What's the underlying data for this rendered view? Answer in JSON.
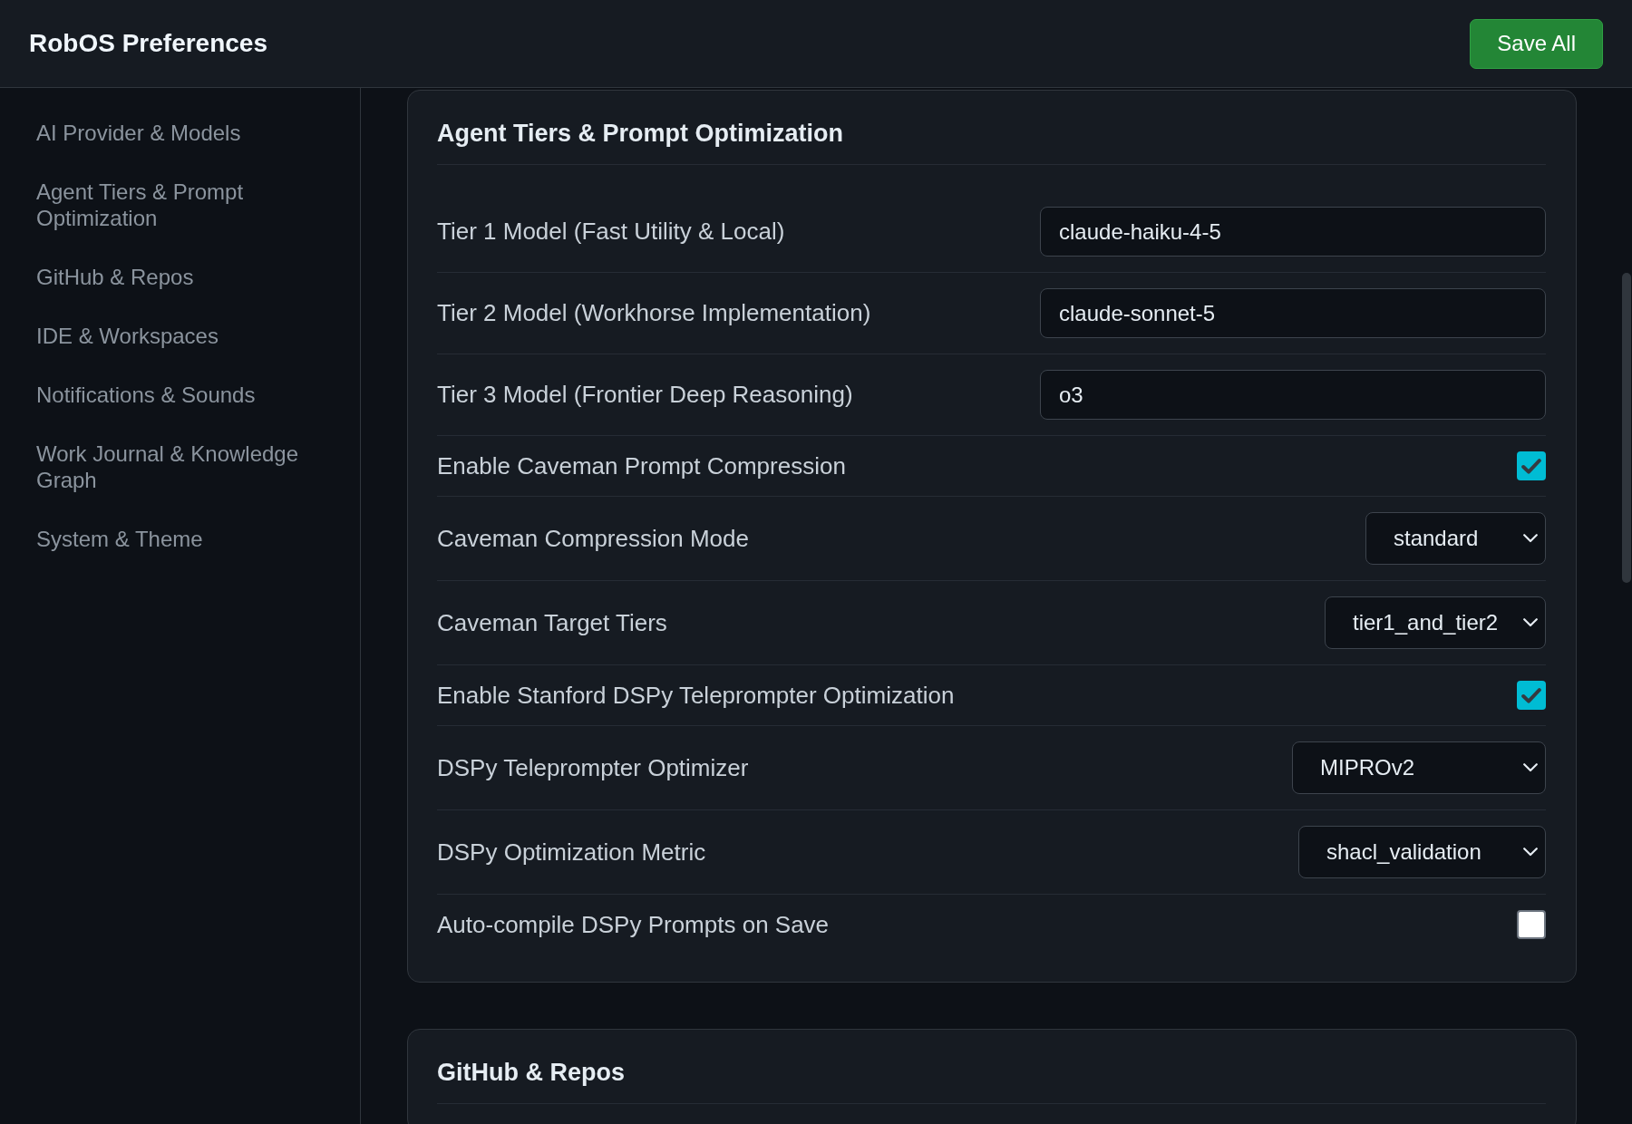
{
  "header": {
    "title": "RobOS Preferences",
    "save_button": "Save All"
  },
  "sidebar": {
    "items": [
      "AI Provider & Models",
      "Agent Tiers & Prompt Optimization",
      "GitHub & Repos",
      "IDE & Workspaces",
      "Notifications & Sounds",
      "Work Journal & Knowledge Graph",
      "System & Theme"
    ]
  },
  "sections": [
    {
      "title": "Agent Tiers & Prompt Optimization",
      "settings": [
        {
          "kind": "text",
          "label": "Tier 1 Model (Fast Utility & Local)",
          "value": "claude-haiku-4-5"
        },
        {
          "kind": "text",
          "label": "Tier 2 Model (Workhorse Implementation)",
          "value": "claude-sonnet-5"
        },
        {
          "kind": "text",
          "label": "Tier 3 Model (Frontier Deep Reasoning)",
          "value": "o3"
        },
        {
          "kind": "checkbox",
          "label": "Enable Caveman Prompt Compression",
          "checked": true
        },
        {
          "kind": "select",
          "label": "Caveman Compression Mode",
          "value": "standard"
        },
        {
          "kind": "select",
          "label": "Caveman Target Tiers",
          "value": "tier1_and_tier2"
        },
        {
          "kind": "checkbox",
          "label": "Enable Stanford DSPy Teleprompter Optimization",
          "checked": true
        },
        {
          "kind": "select",
          "label": "DSPy Teleprompter Optimizer",
          "value": "MIPROv2"
        },
        {
          "kind": "select",
          "label": "DSPy Optimization Metric",
          "value": "shacl_validation"
        },
        {
          "kind": "checkbox",
          "label": "Auto-compile DSPy Prompts on Save",
          "checked": false
        }
      ]
    },
    {
      "title": "GitHub & Repos"
    }
  ]
}
